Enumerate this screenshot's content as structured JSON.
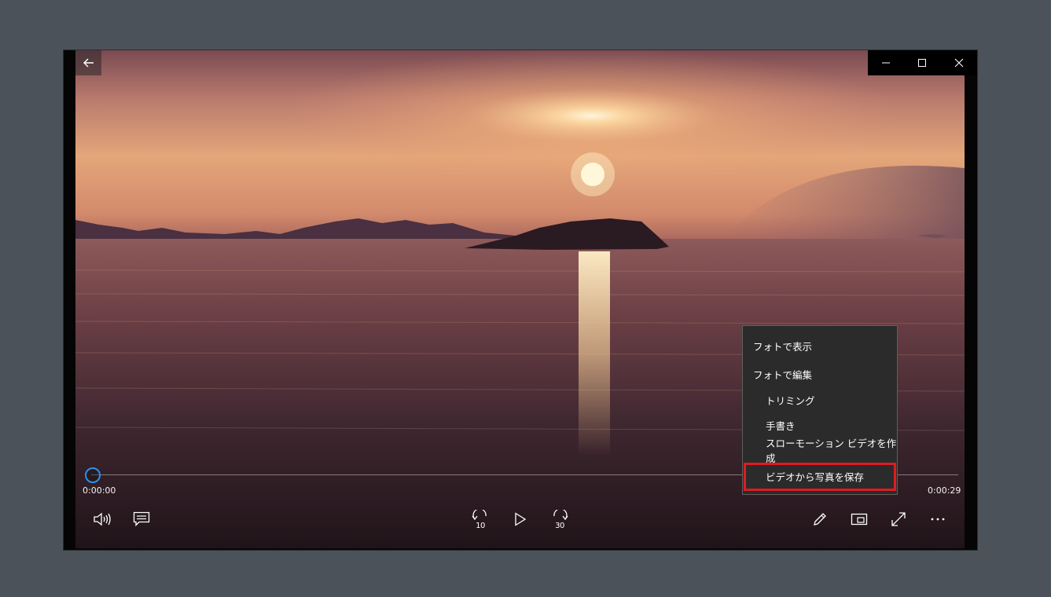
{
  "window": {
    "title_controls": {
      "minimize_icon": "minimize-icon",
      "maximize_icon": "maximize-icon",
      "close_icon": "close-icon"
    },
    "back_icon": "back-arrow-icon"
  },
  "player": {
    "current_time": "0:00:00",
    "total_time": "0:00:29",
    "progress": 0,
    "skip_back_seconds": "10",
    "skip_forward_seconds": "30",
    "accent_color": "#2f8fe8"
  },
  "context_menu": {
    "items": [
      {
        "label": "フォトで表示",
        "level": "top"
      },
      {
        "label": "フォトで編集",
        "level": "top"
      },
      {
        "label": "トリミング",
        "level": "sub"
      },
      {
        "label": "手書き",
        "level": "sub"
      },
      {
        "label": "スローモーション ビデオを作成",
        "level": "sub"
      },
      {
        "label": "ビデオから写真を保存",
        "level": "sub",
        "highlighted": true
      }
    ],
    "highlight_color": "#e11b22"
  }
}
